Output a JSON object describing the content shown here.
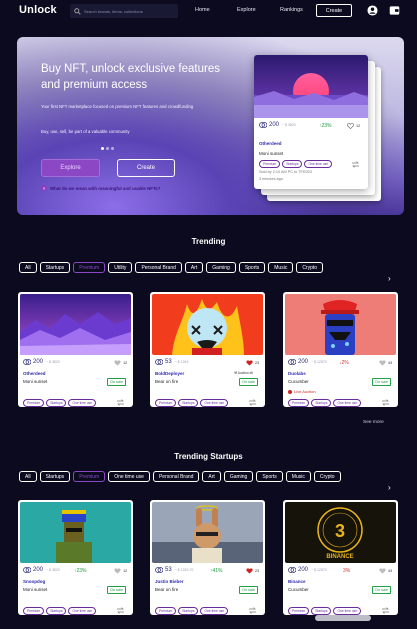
{
  "nav": {
    "logo": "Unlock",
    "search_placeholder": "Search brands, items, collections",
    "links": [
      "Home",
      "Explore",
      "Rankings"
    ],
    "create_label": "Create",
    "icons": [
      "account-icon",
      "wallet-icon"
    ]
  },
  "hero": {
    "title": "Buy NFT, unlock exclusive features and premium access",
    "desc": "Your first NFT marketplace focused on premium NFT features and crowdfunding",
    "desc2": "Buy, use, sell, be part of a valuable community",
    "explore_label": "Explore",
    "create_label": "Create",
    "question": "What do we mean with meaningful and usable NFTs?",
    "card": {
      "price": "200",
      "usd": "~ $ 3820",
      "change": "23%",
      "likes": "12",
      "creator": "Otherdeed",
      "name": "Moni sunset",
      "tags": [
        "Premium",
        "Startups",
        "One time use"
      ],
      "sold": "Sold by 2:10 AM PC to TFR203",
      "ago": "3 minutes ago"
    }
  },
  "trending": {
    "title": "Trending",
    "filters": [
      "All",
      "Startups",
      "Premium",
      "Utility",
      "Personal Brand",
      "Art",
      "Gaming",
      "Sports",
      "Music",
      "Crypto"
    ],
    "active_filter": "Premium",
    "cards": [
      {
        "price": "200",
        "usd": "~ $ 3820",
        "likes": "12",
        "creator": "Otherdeed",
        "name": "Moni sunset",
        "status": "On sale",
        "tags": [
          "Premium",
          "Startups",
          "One time use"
        ]
      },
      {
        "price": "53",
        "usd": "~ $ 1243",
        "likes": "23",
        "creator": "BoldDeployer",
        "name": "Bear on fire",
        "status": "On sale",
        "auction": "Auction ell",
        "tags": [
          "Premium",
          "Startups",
          "One time use"
        ]
      },
      {
        "price": "200",
        "usd": "~ $ 12670",
        "change": "2%",
        "likes": "43",
        "creator": "Duolabs",
        "name": "Cucumber",
        "status": "On sale",
        "live": "Live Auction",
        "tags": [
          "Premium",
          "Startups",
          "One time use"
        ]
      }
    ],
    "see_more": "See more"
  },
  "startups": {
    "title": "Trending Startups",
    "filters": [
      "All",
      "Startups",
      "Premium",
      "One time use",
      "Personal Brand",
      "Art",
      "Gaming",
      "Sports",
      "Music",
      "Crypto"
    ],
    "active_filter": "Premium",
    "cards": [
      {
        "price": "200",
        "usd": "~ $ 3820",
        "change": "23%",
        "likes": "12",
        "creator": "Snoopdog",
        "name": "Moni sunset",
        "status": "On sale",
        "tags": [
          "Premium",
          "Startups",
          "One time use"
        ]
      },
      {
        "price": "53",
        "usd": "~ $ 1243.70",
        "change": "41%",
        "likes": "23",
        "creator": "Justin Bieber",
        "name": "Bear on fire",
        "status": "On sale",
        "tags": [
          "Premium",
          "Startups",
          "One time use"
        ]
      },
      {
        "price": "200",
        "usd": "~ $ 12670",
        "change": "3%",
        "likes": "43",
        "creator": "Binance",
        "name": "Cucumber",
        "status": "On sale",
        "tags": [
          "Premium",
          "Startups",
          "One time use"
        ],
        "img_text": "BINANCE"
      }
    ]
  },
  "colors": {
    "bg": "#0b0a1f",
    "accent": "#8b47c4",
    "up": "#1b9c3a",
    "down": "#d23030"
  }
}
